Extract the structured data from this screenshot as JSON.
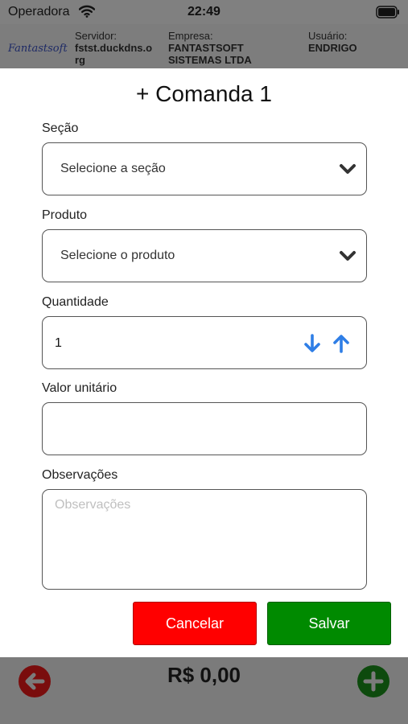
{
  "status_bar": {
    "carrier": "Operadora",
    "time": "22:49"
  },
  "header": {
    "logo": "Fantastsoft",
    "server_label": "Servidor:",
    "server_value": "fstst.duckdns.o rg",
    "company_label": "Empresa:",
    "company_value": "FANTASTSOFT SISTEMAS LTDA",
    "user_label": "Usuário:",
    "user_value": "ENDRIGO"
  },
  "modal": {
    "title": "+ Comanda 1",
    "section_label": "Seção",
    "section_value": "Selecione a seção",
    "product_label": "Produto",
    "product_value": "Selecione o produto",
    "quantity_label": "Quantidade",
    "quantity_value": "1",
    "unit_value_label": "Valor unitário",
    "unit_value": "",
    "notes_label": "Observações",
    "notes_placeholder": "Observações",
    "cancel_label": "Cancelar",
    "save_label": "Salvar"
  },
  "footer": {
    "total": "R$ 0,00"
  },
  "colors": {
    "cancel": "#ff0000",
    "save": "#008a00",
    "arrows": "#2f7ee6"
  }
}
